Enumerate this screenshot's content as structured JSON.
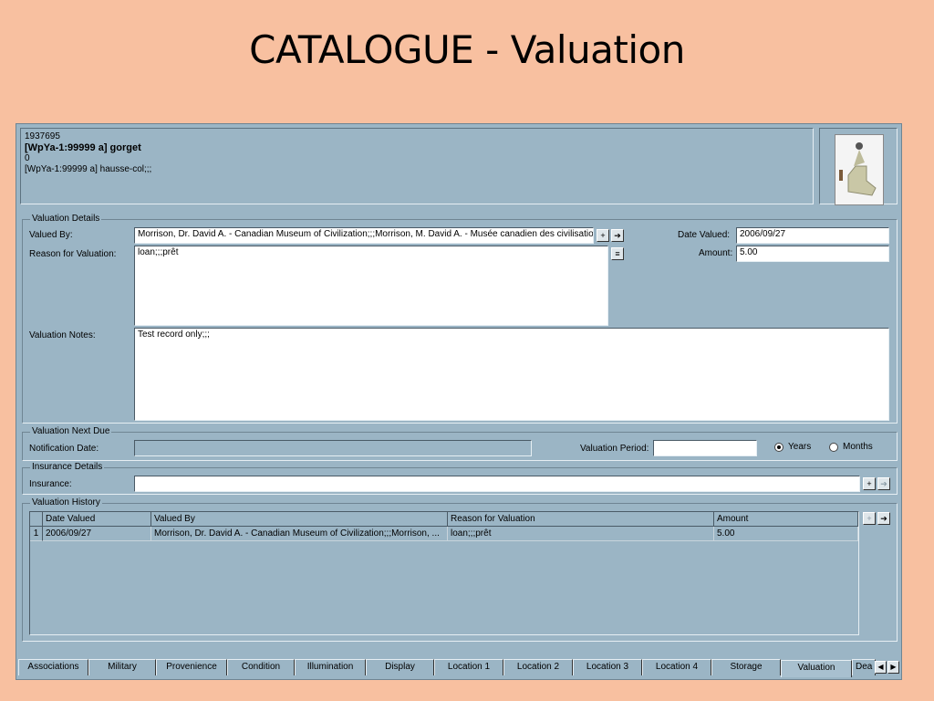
{
  "slide": {
    "title": "CATALOGUE - Valuation"
  },
  "record": {
    "id": "1937695",
    "name": "[WpYa-1:99999 a] gorget",
    "count": "0",
    "alt_name": "[WpYa-1:99999 a] hausse-col;;;"
  },
  "thumbnail": {
    "icon": "artifact-photo"
  },
  "valuation_details": {
    "legend": "Valuation Details",
    "valued_by_label": "Valued By:",
    "valued_by_value": "Morrison, Dr. David A. - Canadian Museum of Civilization;;;Morrison, M. David A. - Musée canadien des civilisatio",
    "reason_label": "Reason for Valuation:",
    "reason_value": "loan;;;prêt",
    "date_label": "Date Valued:",
    "date_value": "2006/09/27",
    "amount_label": "Amount:",
    "amount_value": "5.00",
    "notes_label": "Valuation Notes:",
    "notes_value": "Test record only;;;"
  },
  "next_due": {
    "legend": "Valuation Next Due",
    "notification_label": "Notification Date:",
    "notification_value": "",
    "period_label": "Valuation Period:",
    "period_value": "",
    "years_label": "Years",
    "months_label": "Months",
    "selected": "Years"
  },
  "insurance": {
    "legend": "Insurance Details",
    "insurance_label": "Insurance:",
    "insurance_value": ""
  },
  "history": {
    "legend": "Valuation History",
    "columns": [
      "Date Valued",
      "Valued By",
      "Reason for Valuation",
      "Amount"
    ],
    "rows": [
      {
        "num": "1",
        "date": "2006/09/27",
        "valued_by": "Morrison, Dr. David A. - Canadian Museum of Civilization;;;Morrison, ...",
        "reason": "loan;;;prêt",
        "amount": "5.00"
      }
    ]
  },
  "tabs": [
    "Associations",
    "Military",
    "Provenience",
    "Condition",
    "Illumination",
    "Display",
    "Location 1",
    "Location 2",
    "Location 3",
    "Location 4",
    "Storage",
    "Valuation",
    "Dea"
  ],
  "active_tab": "Valuation"
}
